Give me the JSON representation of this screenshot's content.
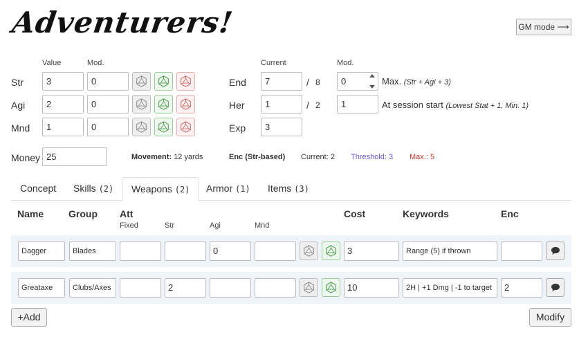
{
  "app": {
    "title": "Adventurers!",
    "gm_mode_label": "GM mode ⟶"
  },
  "stats": {
    "col_value": "Value",
    "col_mod": "Mod.",
    "rows": [
      {
        "label": "Str",
        "value": "3",
        "mod": "0"
      },
      {
        "label": "Agi",
        "value": "2",
        "mod": "0"
      },
      {
        "label": "Mnd",
        "value": "1",
        "mod": "0"
      }
    ],
    "money_label": "Money",
    "money_value": "25"
  },
  "derived": {
    "col_current": "Current",
    "col_mod": "Mod.",
    "end": {
      "label": "End",
      "current": "7",
      "slash": "/",
      "max": "8",
      "mod": "0",
      "note_main": "Max.",
      "note_italic": "(Str + Agi + 3)"
    },
    "her": {
      "label": "Her",
      "current": "1",
      "slash": "/",
      "max": "2",
      "mod": "1",
      "note_main": "At session start",
      "note_italic": "(Lowest Stat + 1, Min. 1)"
    },
    "exp": {
      "label": "Exp",
      "current": "3"
    }
  },
  "summary": {
    "movement_label": "Movement:",
    "movement_value": "12 yards",
    "enc_label": "Enc (Str-based)",
    "current_label": "Current:",
    "current_value": "2",
    "threshold_label": "Threshold:",
    "threshold_value": "3",
    "max_label": "Max.:",
    "max_value": "5",
    "threshold_color": "#6a5acd",
    "max_color": "#c0392b"
  },
  "tabs": [
    {
      "label": "Concept",
      "count": ""
    },
    {
      "label": "Skills",
      "count": "(2)"
    },
    {
      "label": "Weapons",
      "count": "(2)"
    },
    {
      "label": "Armor",
      "count": "(1)"
    },
    {
      "label": "Items",
      "count": "(3)"
    }
  ],
  "weapons": {
    "headers": {
      "name": "Name",
      "group": "Group",
      "att": "Att",
      "fixed": "Fixed",
      "str": "Str",
      "agi": "Agi",
      "mnd": "Mnd",
      "cost": "Cost",
      "keywords": "Keywords",
      "enc": "Enc"
    },
    "rows": [
      {
        "name": "Dagger",
        "group": "Blades",
        "fixed": "",
        "str": "",
        "agi": "0",
        "mnd": "",
        "cost": "3",
        "keywords": "Range (5) if thrown",
        "enc": ""
      },
      {
        "name": "Greataxe",
        "group": "Clubs/Axes",
        "fixed": "",
        "str": "2",
        "agi": "",
        "mnd": "",
        "cost": "10",
        "keywords": "2H | +1 Dmg | -1 to target",
        "enc": "2"
      }
    ]
  },
  "actions": {
    "add_label": "+Add",
    "modify_label": "Modify"
  },
  "icons": {
    "die": "d20-die-icon",
    "comment": "speech-bubble-icon"
  }
}
